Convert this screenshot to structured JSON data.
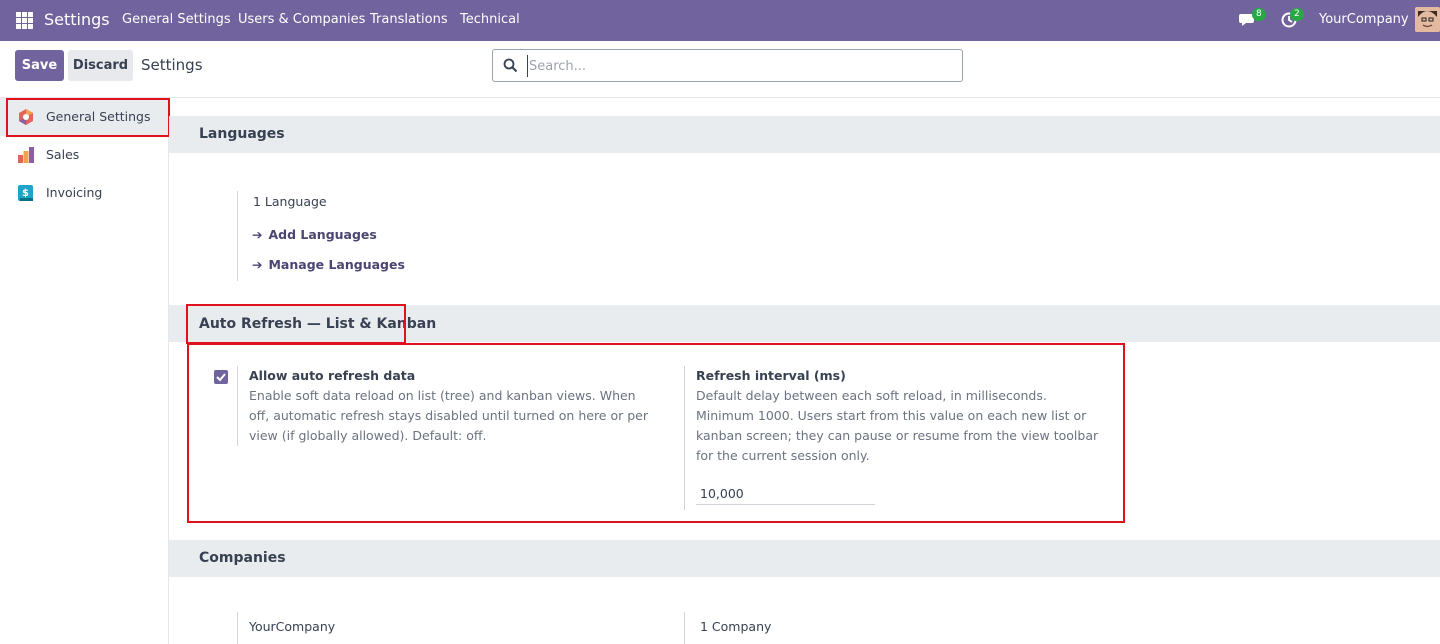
{
  "navbar": {
    "app_title": "Settings",
    "menu": [
      "General Settings",
      "Users & Companies",
      "Translations",
      "Technical"
    ],
    "messages_count": "8",
    "activities_count": "2",
    "company": "YourCompany"
  },
  "control_panel": {
    "save_label": "Save",
    "discard_label": "Discard",
    "title": "Settings",
    "search_placeholder": "Search..."
  },
  "sidebar": {
    "items": [
      {
        "label": "General Settings",
        "icon": "general-settings-icon"
      },
      {
        "label": "Sales",
        "icon": "sales-icon"
      },
      {
        "label": "Invoicing",
        "icon": "invoicing-icon"
      }
    ]
  },
  "languages": {
    "title": "Languages",
    "count": "1 Language",
    "add_link": "Add Languages",
    "manage_link": "Manage Languages"
  },
  "auto_refresh": {
    "title": "Auto Refresh — List & Kanban",
    "allow_label": "Allow auto refresh data",
    "allow_checked": true,
    "allow_help": [
      "Enable soft data reload on list (tree) and kanban views. When",
      "off, automatic refresh stays disabled until turned on here or per",
      "view (if globally allowed). Default: off."
    ],
    "interval_label": "Refresh interval (ms)",
    "interval_help": [
      "Default delay between each soft reload, in milliseconds.",
      "Minimum 1000. Users start from this value on each new list or",
      "kanban screen; they can pause or resume from the view toolbar",
      "for the current session only."
    ],
    "interval_value": "10,000"
  },
  "companies": {
    "title": "Companies",
    "company_name": "YourCompany",
    "company_count": "1 Company"
  },
  "colors": {
    "navbar": "#71639e",
    "highlight": "#e0101d",
    "badge": "#28a745",
    "link": "#4a4573"
  }
}
